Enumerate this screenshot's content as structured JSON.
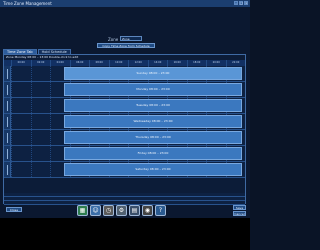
{
  "window": {
    "title": "Time Zone Management",
    "controls": [
      "–",
      "□",
      "×"
    ]
  },
  "room": {
    "label": "Zone",
    "selected": "Zone"
  },
  "copy_button": "Copy Time Zone from Schedule",
  "tabs": [
    {
      "label": "Time Zone Tab",
      "active": true
    },
    {
      "label": "Hold Schedule",
      "active": false
    }
  ],
  "info_bar": "Zone  Monday 08:00 – 13:00  Double-click to edit",
  "hours": [
    "00:00",
    "02:00",
    "04:00",
    "06:00",
    "08:00",
    "10:00",
    "12:00",
    "14:00",
    "16:00",
    "18:00",
    "20:00",
    "22:00"
  ],
  "days": [
    {
      "slot": "Sunday 08:00 – 23:00",
      "highlight": true
    },
    {
      "slot": "Monday 08:00 – 23:00",
      "highlight": false
    },
    {
      "slot": "Tuesday 08:00 – 23:00",
      "highlight": false
    },
    {
      "slot": "Wednesday 08:00 – 23:00",
      "highlight": false
    },
    {
      "slot": "Thursday 08:00 – 23:00",
      "highlight": false
    },
    {
      "slot": "Friday 08:00 – 23:00",
      "highlight": false
    },
    {
      "slot": "Saturday 08:00 – 23:00",
      "highlight": false
    }
  ],
  "buttons": {
    "close": "Close",
    "save": "Save",
    "cancel": "Cancel"
  },
  "dock_icons": [
    {
      "name": "calendar-icon",
      "glyph": "▦",
      "color": "#2e7d4f"
    },
    {
      "name": "users-icon",
      "glyph": "☺",
      "color": "#3b6ea8"
    },
    {
      "name": "schedule-icon",
      "glyph": "◷",
      "color": "#5a5a5a"
    },
    {
      "name": "settings-icon",
      "glyph": "⚙",
      "color": "#506070"
    },
    {
      "name": "report-icon",
      "glyph": "▤",
      "color": "#3a4f6a"
    },
    {
      "name": "camera-icon",
      "glyph": "◉",
      "color": "#444444"
    },
    {
      "name": "help-icon",
      "glyph": "?",
      "color": "#2a5a90"
    }
  ]
}
